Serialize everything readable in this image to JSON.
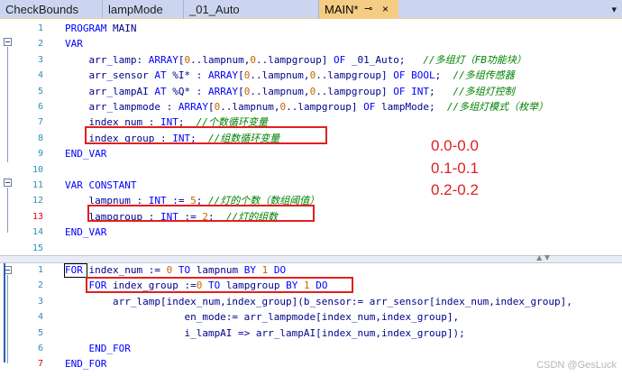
{
  "tabs": [
    {
      "label": "CheckBounds"
    },
    {
      "label": "lampMode"
    },
    {
      "label": "_01_Auto"
    },
    {
      "label": "MAIN*"
    }
  ],
  "tab_tools": {
    "pin": "⊸",
    "close": "×",
    "dropdown": "▾"
  },
  "declaration_lines": [
    {
      "n": "1",
      "tokens": [
        [
          "kw",
          "PROGRAM "
        ],
        [
          "tx",
          "MAIN"
        ]
      ]
    },
    {
      "n": "2",
      "tokens": [
        [
          "kw",
          "VAR"
        ]
      ]
    },
    {
      "n": "3",
      "tokens": [
        [
          "tx",
          "    arr_lamp: "
        ],
        [
          "kw",
          "ARRAY"
        ],
        [
          "tx",
          "["
        ],
        [
          "num",
          "0"
        ],
        [
          "tx",
          "..lampnum,"
        ],
        [
          "num",
          "0"
        ],
        [
          "tx",
          "..lampgroup] "
        ],
        [
          "kw",
          "OF"
        ],
        [
          "tx",
          " _01_Auto;   "
        ],
        [
          "cm",
          "//多组灯（FB功能块）"
        ]
      ]
    },
    {
      "n": "4",
      "tokens": [
        [
          "tx",
          "    arr_sensor "
        ],
        [
          "kw",
          "AT"
        ],
        [
          "tx",
          " %I* : "
        ],
        [
          "kw",
          "ARRAY"
        ],
        [
          "tx",
          "["
        ],
        [
          "num",
          "0"
        ],
        [
          "tx",
          "..lampnum,"
        ],
        [
          "num",
          "0"
        ],
        [
          "tx",
          "..lampgroup] "
        ],
        [
          "kw",
          "OF BOOL"
        ],
        [
          "tx",
          ";  "
        ],
        [
          "cm",
          "//多组传感器"
        ]
      ]
    },
    {
      "n": "5",
      "tokens": [
        [
          "tx",
          "    arr_lampAI "
        ],
        [
          "kw",
          "AT"
        ],
        [
          "tx",
          " %Q* : "
        ],
        [
          "kw",
          "ARRAY"
        ],
        [
          "tx",
          "["
        ],
        [
          "num",
          "0"
        ],
        [
          "tx",
          "..lampnum,"
        ],
        [
          "num",
          "0"
        ],
        [
          "tx",
          "..lampgroup] "
        ],
        [
          "kw",
          "OF INT"
        ],
        [
          "tx",
          ";   "
        ],
        [
          "cm",
          "//多组灯控制"
        ]
      ]
    },
    {
      "n": "6",
      "tokens": [
        [
          "tx",
          "    arr_lampmode : "
        ],
        [
          "kw",
          "ARRAY"
        ],
        [
          "tx",
          "["
        ],
        [
          "num",
          "0"
        ],
        [
          "tx",
          "..lampnum,"
        ],
        [
          "num",
          "0"
        ],
        [
          "tx",
          "..lampgroup] "
        ],
        [
          "kw",
          "OF"
        ],
        [
          "tx",
          " lampMode;  "
        ],
        [
          "cm",
          "//多组灯模式（枚举）"
        ]
      ]
    },
    {
      "n": "7",
      "tokens": [
        [
          "tx",
          "    index_num : "
        ],
        [
          "kw",
          "INT"
        ],
        [
          "tx",
          ";  "
        ],
        [
          "cm",
          "//个数循环变量"
        ]
      ]
    },
    {
      "n": "8",
      "tokens": [
        [
          "tx",
          "    index_group : "
        ],
        [
          "kw",
          "INT"
        ],
        [
          "tx",
          ";  "
        ],
        [
          "cm",
          "//组数循环变量"
        ]
      ]
    },
    {
      "n": "9",
      "tokens": [
        [
          "kw",
          "END_VAR"
        ]
      ]
    },
    {
      "n": "10",
      "tokens": []
    },
    {
      "n": "11",
      "tokens": [
        [
          "kw",
          "VAR CONSTANT"
        ]
      ]
    },
    {
      "n": "12",
      "tokens": [
        [
          "tx",
          "    lampnum : "
        ],
        [
          "kw",
          "INT"
        ],
        [
          "tx",
          " := "
        ],
        [
          "num",
          "5"
        ],
        [
          "tx",
          "; "
        ],
        [
          "cm",
          "//灯的个数（数组阈值）"
        ]
      ]
    },
    {
      "n": "13",
      "tokens": [
        [
          "tx",
          "    lampgroup : "
        ],
        [
          "kw",
          "INT"
        ],
        [
          "tx",
          " := "
        ],
        [
          "num",
          "2"
        ],
        [
          "tx",
          ";  "
        ],
        [
          "cm",
          "//灯的组数"
        ]
      ]
    },
    {
      "n": "14",
      "tokens": [
        [
          "kw",
          "END_VAR"
        ]
      ]
    },
    {
      "n": "15",
      "tokens": []
    }
  ],
  "body_lines": [
    {
      "n": "1",
      "tokens": [
        [
          "kw",
          "FOR"
        ],
        [
          "tx",
          " index_num := "
        ],
        [
          "num",
          "0"
        ],
        [
          "tx",
          " "
        ],
        [
          "kw",
          "TO"
        ],
        [
          "tx",
          " lampnum "
        ],
        [
          "kw",
          "BY"
        ],
        [
          "tx",
          " "
        ],
        [
          "num",
          "1"
        ],
        [
          "tx",
          " "
        ],
        [
          "kw",
          "DO"
        ]
      ]
    },
    {
      "n": "2",
      "tokens": [
        [
          "tx",
          "    "
        ],
        [
          "kw",
          "FOR"
        ],
        [
          "tx",
          " index_group :="
        ],
        [
          "num",
          "0"
        ],
        [
          "tx",
          " "
        ],
        [
          "kw",
          "TO"
        ],
        [
          "tx",
          " lampgroup "
        ],
        [
          "kw",
          "BY"
        ],
        [
          "tx",
          " "
        ],
        [
          "num",
          "1"
        ],
        [
          "tx",
          " "
        ],
        [
          "kw",
          "DO"
        ]
      ]
    },
    {
      "n": "3",
      "tokens": [
        [
          "tx",
          "        arr_lamp[index_num,index_group](b_sensor:= arr_sensor[index_num,index_group],"
        ]
      ]
    },
    {
      "n": "4",
      "tokens": [
        [
          "tx",
          "                    en_mode:= arr_lampmode[index_num,index_group],"
        ]
      ]
    },
    {
      "n": "5",
      "tokens": [
        [
          "tx",
          "                    i_lampAI => arr_lampAI[index_num,index_group]);"
        ]
      ]
    },
    {
      "n": "6",
      "tokens": [
        [
          "tx",
          "    "
        ],
        [
          "kw",
          "END_FOR"
        ]
      ]
    },
    {
      "n": "7",
      "tokens": [
        [
          "kw",
          "END_FOR"
        ]
      ]
    }
  ],
  "annotations": [
    "0.0-0.0",
    "0.1-0.1",
    "0.2-0.2"
  ],
  "watermark": "CSDN @GesLuck"
}
